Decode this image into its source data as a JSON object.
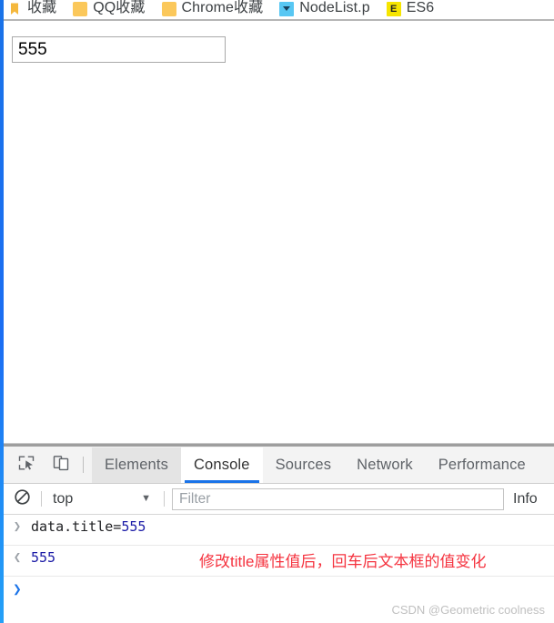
{
  "browser": {
    "bookmarks_bar": {
      "items": [
        {
          "label": "收藏",
          "icon": "bookmark-ribbon-icon",
          "icon_type": "bookmark",
          "color": "#f5b83d"
        },
        {
          "label": "QQ收藏",
          "icon": "folder-icon",
          "icon_type": "folder",
          "color": "#fbc85b"
        },
        {
          "label": "Chrome收藏",
          "icon": "folder-icon",
          "icon_type": "folder",
          "color": "#fbc85b"
        },
        {
          "label": "NodeList.p",
          "icon": "site-favicon-icon",
          "icon_type": "square-blue",
          "color": "#58c7f3"
        },
        {
          "label": "ES6",
          "icon": "site-favicon-icon",
          "icon_type": "square-yellow",
          "color": "#f6e500"
        }
      ]
    },
    "edge_strip_color": "#1a73e8"
  },
  "page": {
    "text_input": {
      "value": "555",
      "placeholder": ""
    }
  },
  "devtools": {
    "toolbar": {
      "inspect_icon": "inspect-element-icon",
      "device_toolbar_icon": "device-toolbar-icon"
    },
    "tabs": [
      {
        "label": "Elements",
        "state": "hovered"
      },
      {
        "label": "Console",
        "state": "active"
      },
      {
        "label": "Sources",
        "state": "normal"
      },
      {
        "label": "Network",
        "state": "normal"
      },
      {
        "label": "Performance",
        "state": "normal"
      }
    ],
    "active_tab_accent": "#1a73e8",
    "console_filterbar": {
      "clear_icon": "clear-console-icon",
      "context": "top",
      "context_caret": "▼",
      "filter_placeholder": "Filter",
      "filter_value": "",
      "level": "Info"
    },
    "console_messages": [
      {
        "type": "input",
        "gutter": "❯",
        "text": "data.title=",
        "value": "555"
      },
      {
        "type": "result",
        "gutter": "❮",
        "text": "555"
      },
      {
        "type": "prompt",
        "gutter": "❯",
        "text": ""
      }
    ]
  },
  "annotation": {
    "note": "修改title属性值后，回车后文本框的值变化",
    "color": "#f5333f"
  },
  "watermark": {
    "text": "CSDN @Geometric coolness"
  }
}
